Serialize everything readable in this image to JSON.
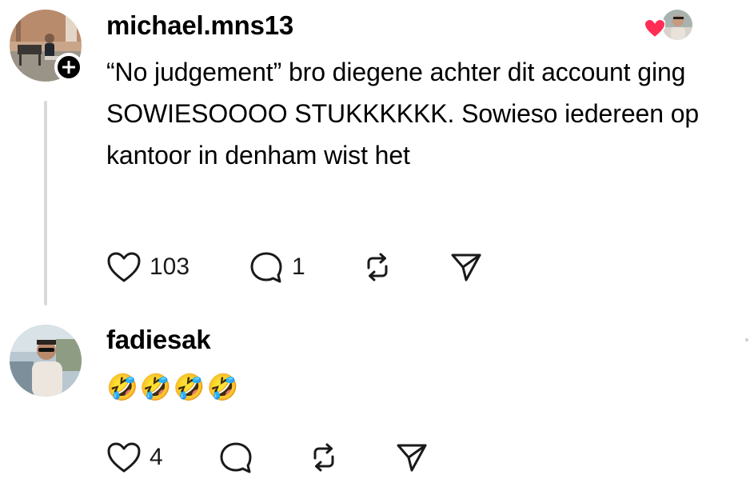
{
  "comments": [
    {
      "username": "michael.mns13",
      "text": "“No judgement” bro diegene achter dit account ging SOWIESOOOO STUKKKKKK. Sowieso iedereen op kantoor in denham wist het",
      "likes": "103",
      "replies": "1",
      "liked_by_author": true
    },
    {
      "username": "fadiesak",
      "emoji": [
        "🤣",
        "🤣",
        "🤣",
        "🤣"
      ],
      "likes": "4",
      "replies": ""
    }
  ],
  "icons": {
    "like": "heart-outline-icon",
    "reply": "speech-bubble-icon",
    "repost": "repost-arrows-icon",
    "share": "paper-plane-icon",
    "follow": "plus-icon",
    "liked": "red-heart-icon"
  },
  "colors": {
    "text": "#000000",
    "icon": "#1a1a1a",
    "heart": "#ff2d55",
    "thread_line": "#d9d9d9"
  }
}
